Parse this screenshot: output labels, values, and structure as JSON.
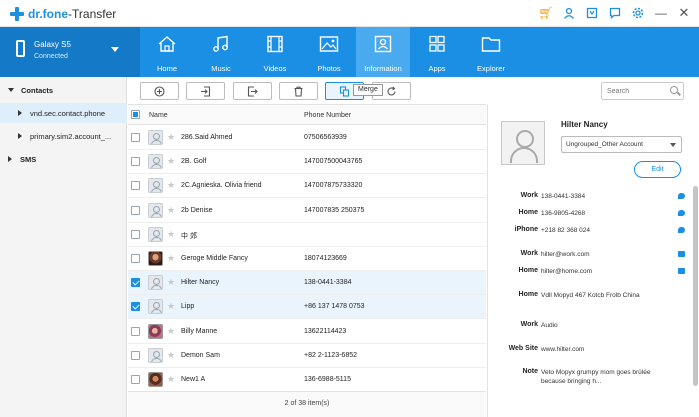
{
  "app": {
    "brand": "dr.fone",
    "module": "-Transfer"
  },
  "device": {
    "name": "Galaxy S5",
    "status": "Connected"
  },
  "nav": [
    {
      "label": "Home",
      "icon": "house-icon"
    },
    {
      "label": "Music",
      "icon": "music-note-icon"
    },
    {
      "label": "Videos",
      "icon": "film-icon"
    },
    {
      "label": "Photos",
      "icon": "image-icon"
    },
    {
      "label": "Information",
      "icon": "contact-card-icon"
    },
    {
      "label": "Apps",
      "icon": "apps-grid-icon"
    },
    {
      "label": "Explorer",
      "icon": "folder-icon"
    }
  ],
  "sidebar": {
    "contacts": "Contacts",
    "accounts": [
      "vnd.sec.contact.phone",
      "primary.sim2.account_..."
    ],
    "sms": "SMS"
  },
  "toolbar": {
    "tooltip": "Merge",
    "search_placeholder": "Search"
  },
  "table": {
    "columns": {
      "name": "Name",
      "phone": "Phone Number"
    },
    "rows": [
      {
        "name": "286.Said Ahmed",
        "phone": "07506563939",
        "checked": false,
        "avatar": "default"
      },
      {
        "name": "2B. Golf",
        "phone": "147007500043765",
        "checked": false,
        "avatar": "default"
      },
      {
        "name": "2C.Agnieska. Olivia friend",
        "phone": "147007875733320",
        "checked": false,
        "avatar": "default"
      },
      {
        "name": "2b Denise",
        "phone": "147007835 250375",
        "checked": false,
        "avatar": "default"
      },
      {
        "name": "中 郊",
        "phone": "",
        "checked": false,
        "avatar": "default"
      },
      {
        "name": "Geroge Middle Fancy",
        "phone": "18074123669",
        "checked": false,
        "avatar": "photo"
      },
      {
        "name": "Hilter  Nancy",
        "phone": "138-0441-3384",
        "checked": true,
        "avatar": "default"
      },
      {
        "name": "Lipp",
        "phone": "+86 137 1478 0753",
        "checked": true,
        "avatar": "default"
      },
      {
        "name": "Billy  Manne",
        "phone": "13622114423",
        "checked": false,
        "avatar": "photo2"
      },
      {
        "name": "Demon  Sam",
        "phone": "+82 2-1123-6852",
        "checked": false,
        "avatar": "default"
      },
      {
        "name": "New1  A",
        "phone": "136-6988-5115",
        "checked": false,
        "avatar": "photo3"
      }
    ],
    "footer": "2  of  38  item(s)"
  },
  "detail": {
    "name": "Hilter  Nancy",
    "group": "Ungrouped_Other Account",
    "edit_label": "Edit",
    "fields": [
      {
        "label": "Work",
        "value": "138-0441-3384",
        "icon": "message-icon"
      },
      {
        "label": "Home",
        "value": "136-9805-4268",
        "icon": "message-icon"
      },
      {
        "label": "iPhone",
        "value": "+218 82 368 024",
        "icon": "message-icon"
      },
      {
        "label": "Work",
        "value": "hilter@work.com",
        "icon": "mail-icon"
      },
      {
        "label": "Home",
        "value": "hilter@home.com",
        "icon": "mail-icon"
      },
      {
        "label": "Home",
        "value": "Vdll Mopyd 467 Kotcb Frolb China",
        "icon": ""
      },
      {
        "label": "Work",
        "value": "Audio",
        "icon": ""
      },
      {
        "label": "Web Site",
        "value": "www.hilter.com",
        "icon": ""
      },
      {
        "label": "Note",
        "value": "Veto Mopyx grumpy mom goes brûlée because bringing h...",
        "icon": ""
      }
    ]
  },
  "colors": {
    "accent": "#1a8fe3",
    "nav_active": "#4aaaf0",
    "device_bg": "#1479c6"
  }
}
